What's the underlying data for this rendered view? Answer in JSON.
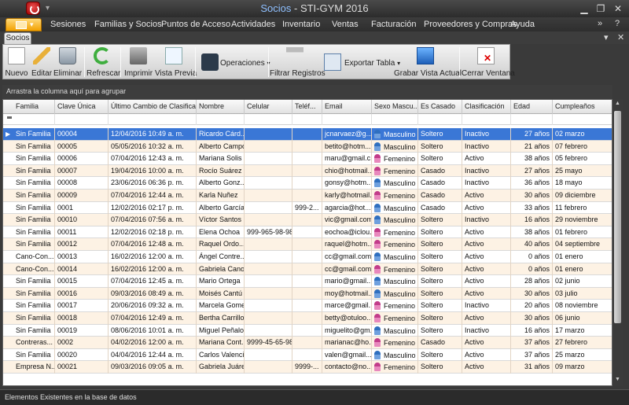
{
  "window": {
    "title_part1": "Socios",
    "title_sep": " - ",
    "title_part2": "STI-GYM 2016"
  },
  "menu": [
    "Sesiones",
    "Familias y Socios",
    "Puntos de Acceso",
    "Actividades",
    "Inventario",
    "Ventas",
    "Facturación",
    "Proveedores y Compras",
    "Ayuda"
  ],
  "tab": "Socios",
  "ribbon": {
    "nuevo": "Nuevo",
    "editar": "Editar",
    "eliminar": "Eliminar",
    "refrescar": "Refrescar",
    "imprimir": "Imprimir",
    "vista_previa": "Vista Previa",
    "operaciones": "Operaciones",
    "filtrar": "Filtrar Registros",
    "exportar": "Exportar Tabla",
    "grabar": "Grabar Vista Actual",
    "cerrar": "Cerrar Ventana"
  },
  "group_panel": "Arrastra la columna aquí para agrupar",
  "columns": [
    "Familia",
    "Clave Única",
    "Último Cambio de Clasifica...",
    "Nombre",
    "Celular",
    "Teléf...",
    "Email",
    "Sexo Mascu...",
    "Es Casado",
    "Clasificación",
    "Edad",
    "Cumpleaños"
  ],
  "rows": [
    [
      "Sin Familia",
      "00004",
      "12/04/2016 10:49 a. m.",
      "Ricardo Cárd...",
      "",
      "",
      "jcnarvaez@g...",
      "Masculino",
      "Soltero",
      "Inactivo",
      "27 años",
      "02 marzo"
    ],
    [
      "Sin Familia",
      "00005",
      "05/05/2016 10:32 a. m.",
      "Alberto Campos",
      "",
      "",
      "betito@hotm...",
      "Masculino",
      "Soltero",
      "Inactivo",
      "21 años",
      "07 febrero"
    ],
    [
      "Sin Familia",
      "00006",
      "07/04/2016 12:43 a. m.",
      "Mariana Solis",
      "",
      "",
      "maru@gmail.c...",
      "Femenino",
      "Soltero",
      "Activo",
      "38 años",
      "05 febrero"
    ],
    [
      "Sin Familia",
      "00007",
      "19/04/2016 10:00 a. m.",
      "Rocío Suárez",
      "",
      "",
      "chio@hotmail...",
      "Femenino",
      "Casado",
      "Inactivo",
      "27 años",
      "25 mayo"
    ],
    [
      "Sin Familia",
      "00008",
      "23/06/2016 06:36 p. m.",
      "Alberto Gonz...",
      "",
      "",
      "gonsy@hotm...",
      "Masculino",
      "Casado",
      "Inactivo",
      "36 años",
      "18 mayo"
    ],
    [
      "Sin Familia",
      "00009",
      "07/04/2016 12:44 a. m.",
      "Karla Nuñez",
      "",
      "",
      "karly@hotmail...",
      "Femenino",
      "Casado",
      "Activo",
      "30 años",
      "09 diciembre"
    ],
    [
      "Sin Familia",
      "0001",
      "12/02/2016 02:17 p. m.",
      "Alberto García",
      "",
      "999-2...",
      "agarcia@hot...",
      "Masculino",
      "Casado",
      "Activo",
      "33 años",
      "11 febrero"
    ],
    [
      "Sin Familia",
      "00010",
      "07/04/2016 07:56 a. m.",
      "Víctor Santos",
      "",
      "",
      "vic@gmail.com",
      "Masculino",
      "Soltero",
      "Inactivo",
      "16 años",
      "29 noviembre"
    ],
    [
      "Sin Familia",
      "00011",
      "12/02/2016 02:18 p. m.",
      "Elena Ochoa",
      "999-965-98-98",
      "",
      "eochoa@iclou...",
      "Femenino",
      "Soltero",
      "Activo",
      "38 años",
      "01 febrero"
    ],
    [
      "Sin Familia",
      "00012",
      "07/04/2016 12:48 a. m.",
      "Raquel Ordo...",
      "",
      "",
      "raquel@hotm...",
      "Femenino",
      "Soltero",
      "Activo",
      "40 años",
      "04 septiembre"
    ],
    [
      "Cano-Con...",
      "00013",
      "16/02/2016 12:00 a. m.",
      "Ángel Contre...",
      "",
      "",
      "cc@gmail.com",
      "Masculino",
      "Soltero",
      "Activo",
      "0 años",
      "01 enero"
    ],
    [
      "Cano-Con...",
      "00014",
      "16/02/2016 12:00 a. m.",
      "Gabriela Cano",
      "",
      "",
      "cc@gmail.com",
      "Femenino",
      "Soltero",
      "Activo",
      "0 años",
      "01 enero"
    ],
    [
      "Sin Familia",
      "00015",
      "07/04/2016 12:45 a. m.",
      "Mario Ortega",
      "",
      "",
      "mario@gmail...",
      "Masculino",
      "Soltero",
      "Activo",
      "28 años",
      "02 junio"
    ],
    [
      "Sin Familia",
      "00016",
      "09/03/2016 08:49 a. m.",
      "Moisés Cantú",
      "",
      "",
      "moy@hotmail...",
      "Masculino",
      "Soltero",
      "Activo",
      "30 años",
      "03 julio"
    ],
    [
      "Sin Familia",
      "00017",
      "20/06/2016 09:32 a. m.",
      "Marcela Gomez",
      "",
      "",
      "marce@gmail...",
      "Femenino",
      "Soltero",
      "Inactivo",
      "20 años",
      "08 noviembre"
    ],
    [
      "Sin Familia",
      "00018",
      "07/04/2016 12:49 a. m.",
      "Bertha Carrillo",
      "",
      "",
      "betty@otuloo...",
      "Femenino",
      "Soltero",
      "Activo",
      "30 años",
      "06 junio"
    ],
    [
      "Sin Familia",
      "00019",
      "08/06/2016 10:01 a. m.",
      "Miguel Peñaloza",
      "",
      "",
      "miguelito@gm...",
      "Masculino",
      "Soltero",
      "Inactivo",
      "16 años",
      "17 marzo"
    ],
    [
      "Contreras...",
      "0002",
      "04/02/2016 12:00 a. m.",
      "Mariana Cont...",
      "9999-45-65-98",
      "",
      "marianac@ho...",
      "Femenino",
      "Casado",
      "Activo",
      "37 años",
      "27 febrero"
    ],
    [
      "Sin Familia",
      "00020",
      "04/04/2016 12:44 a. m.",
      "Carlos Valencia",
      "",
      "",
      "valen@gmail...",
      "Masculino",
      "Soltero",
      "Activo",
      "37 años",
      "25 marzo"
    ],
    [
      "Empresa N...",
      "00021",
      "09/03/2016 09:05 a. m.",
      "Gabriela Juárez",
      "",
      "9999-...",
      "contacto@no...",
      "Femenino",
      "Soltero",
      "Activo",
      "31 años",
      "09 marzo"
    ]
  ],
  "status": "Elementos Existentes en la base de datos"
}
